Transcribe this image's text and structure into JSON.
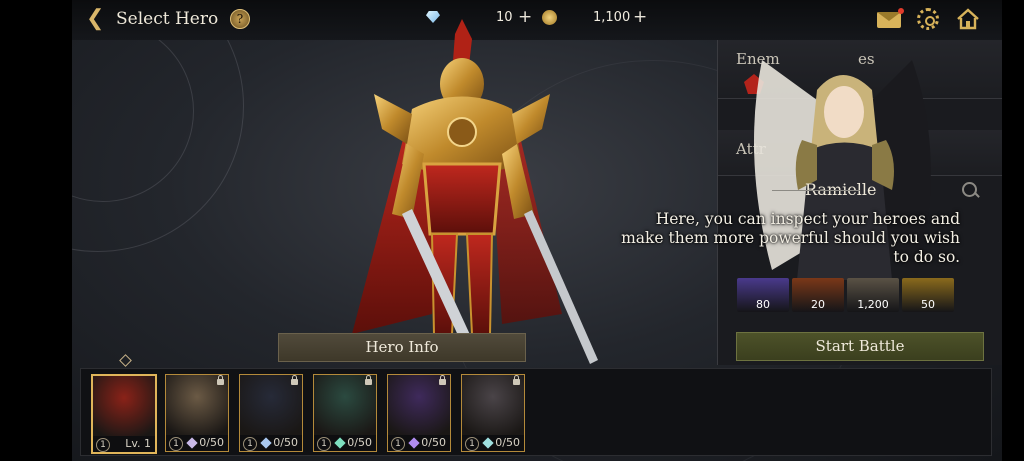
{
  "topbar": {
    "title": "Select Hero",
    "gems": "10",
    "gold": "1,100",
    "plus": "+"
  },
  "panel": {
    "enemy_label": "Enem",
    "enemy_label_tail": "es",
    "attr_label": "Attr"
  },
  "guide": {
    "name": "Ramielle",
    "dialog": "Here, you can inspect your heroes and make them more powerful should you wish to do so."
  },
  "rewards": [
    {
      "value": "80",
      "color": "#4a3a8c"
    },
    {
      "value": "20",
      "color": "#7a3818"
    },
    {
      "value": "1,200",
      "color": "#5a5245"
    },
    {
      "value": "50",
      "color": "#8a6a1c"
    }
  ],
  "buttons": {
    "hero_info": "Hero Info",
    "start_battle": "Start Battle"
  },
  "roster": [
    {
      "badge": "1",
      "level": "Lv. 1",
      "selected": true,
      "tint": "#8a2218"
    },
    {
      "badge": "1",
      "fragments": "0/50",
      "shard_color": "#c9b9e8",
      "tint": "#6b5a45"
    },
    {
      "badge": "1",
      "fragments": "0/50",
      "shard_color": "#a9c8f0",
      "tint": "#262a38"
    },
    {
      "badge": "1",
      "fragments": "0/50",
      "shard_color": "#7fe0c0",
      "tint": "#2b4a40"
    },
    {
      "badge": "1",
      "fragments": "0/50",
      "shard_color": "#b08cf0",
      "tint": "#3f2a5c"
    },
    {
      "badge": "1",
      "fragments": "0/50",
      "shard_color": "#9fe0e0",
      "tint": "#4a4448"
    }
  ]
}
